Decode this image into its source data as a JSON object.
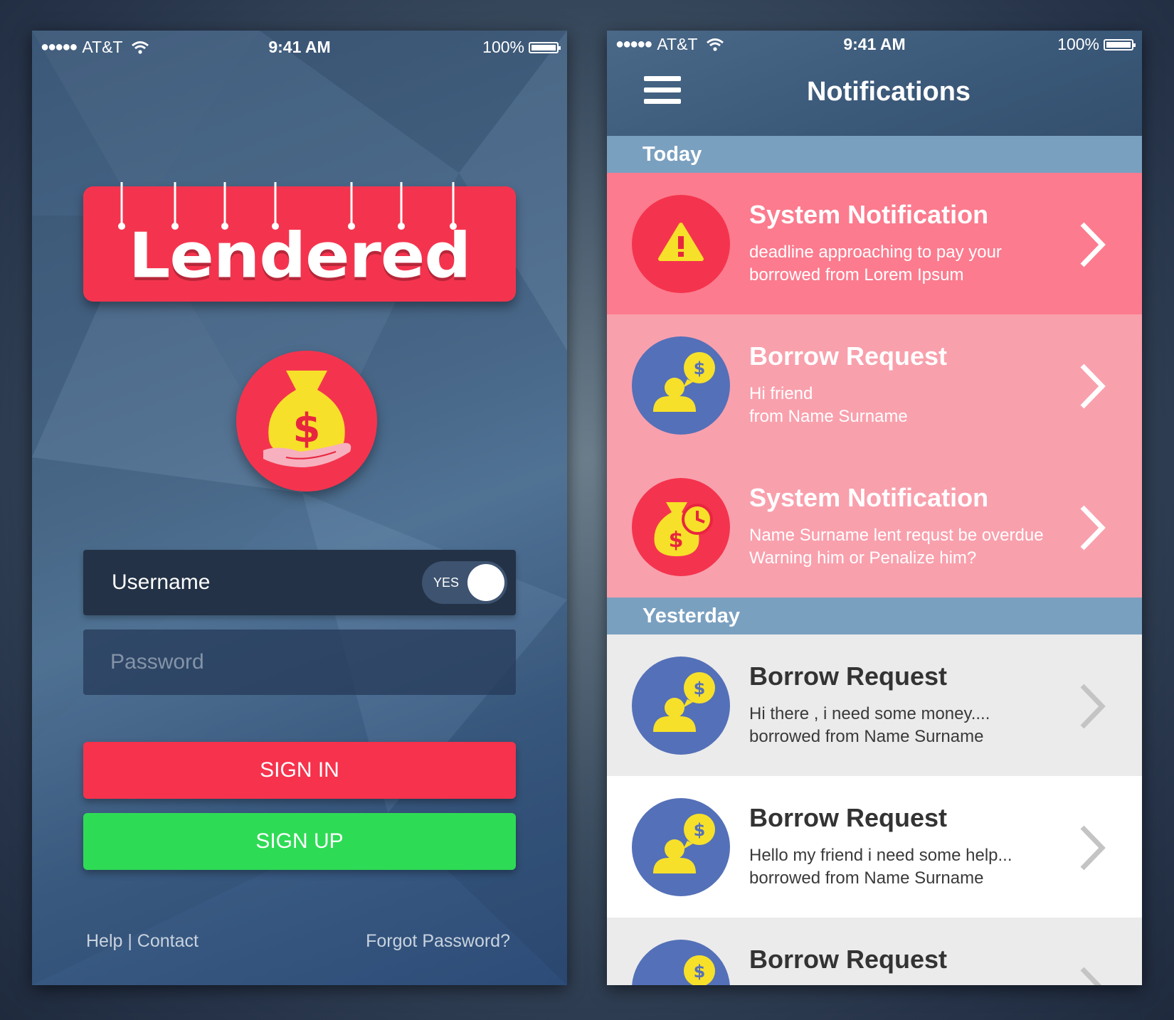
{
  "status": {
    "carrier": "AT&T",
    "time": "9:41 AM",
    "battery": "100%"
  },
  "login": {
    "logo": "Lendered",
    "username_label": "Username",
    "toggle_label": "YES",
    "password_placeholder": "Password",
    "signin_label": "SIGN IN",
    "signup_label": "SIGN UP",
    "help_contact": "Help | Contact",
    "forgot_password": "Forgot Password?"
  },
  "notifications": {
    "title": "Notifications",
    "sections": [
      "Today",
      "Yesterday"
    ],
    "items": [
      {
        "title": "System Notification",
        "line1": "deadline approaching  to pay your",
        "line2": "borrowed from Lorem Ipsum",
        "icon": "warning-icon"
      },
      {
        "title": "Borrow Request",
        "line1": "Hi friend",
        "line2": "from Name Surname",
        "icon": "borrow-request-icon"
      },
      {
        "title": "System Notification",
        "line1": "Name Surname lent requst be overdue",
        "line2": "Warning him or Penalize him?",
        "icon": "overdue-money-icon"
      },
      {
        "title": "Borrow Request",
        "line1": "Hi there , i need some money....",
        "line2": "borrowed from Name Surname",
        "icon": "borrow-request-icon"
      },
      {
        "title": "Borrow Request",
        "line1": "Hello my friend i need some help...",
        "line2": "borrowed from Name Surname",
        "icon": "borrow-request-icon"
      },
      {
        "title": "Borrow Request",
        "line1": "",
        "line2": "",
        "icon": "borrow-request-icon"
      }
    ]
  },
  "colors": {
    "brand_red": "#f4344e",
    "signup_green": "#2edb55",
    "icon_yellow": "#f7e02a",
    "icon_blue": "#5470b8",
    "section_blue": "#7aa0c0"
  }
}
